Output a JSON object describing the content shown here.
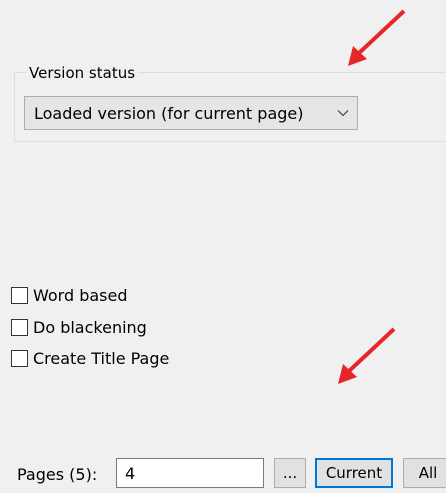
{
  "version_group": {
    "legend": "Version status",
    "selected_option": "Loaded version (for current page)"
  },
  "options": {
    "word_based": {
      "label": "Word based",
      "checked": false
    },
    "do_blackening": {
      "label": "Do blackening",
      "checked": false
    },
    "create_title_page": {
      "label": "Create Title Page",
      "checked": false
    }
  },
  "pages": {
    "label": "Pages (5):",
    "value": "4",
    "browse_label": "...",
    "current_label": "Current",
    "all_label": "All"
  },
  "icons": {
    "combo_chevron": "chevron-down-icon",
    "annotation_arrow": "red-arrow-icon"
  },
  "colors": {
    "annotation_arrow": "#e8262a",
    "focus_border": "#0078d7",
    "background": "#f0f0f0"
  }
}
